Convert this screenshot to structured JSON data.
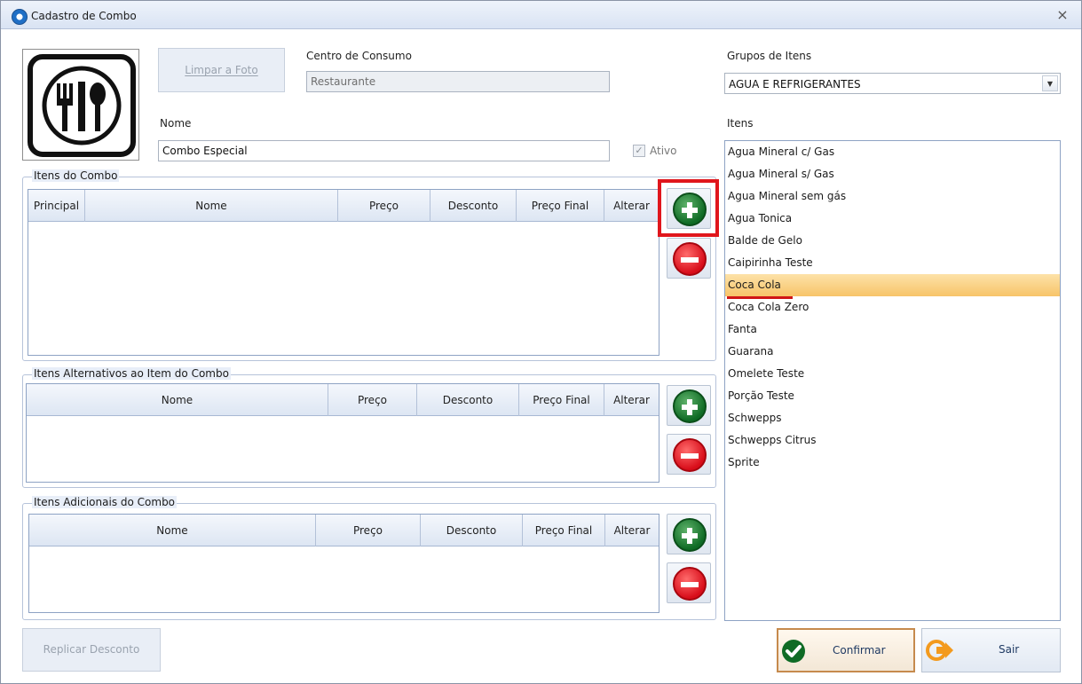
{
  "window": {
    "title": "Cadastro de Combo",
    "close": "×"
  },
  "photo": {
    "clear_button": "Limpar a Foto"
  },
  "centro": {
    "label": "Centro de Consumo",
    "value": "Restaurante"
  },
  "nome": {
    "label": "Nome",
    "value": "Combo Especial"
  },
  "ativo": {
    "label": "Ativo",
    "checked": true
  },
  "grupos": {
    "label": "Grupos de Itens",
    "value": "AGUA E REFRIGERANTES"
  },
  "itens": {
    "label": "Itens",
    "items": [
      "Agua Mineral c/ Gas",
      "Agua Mineral s/ Gas",
      "Agua Mineral sem gás",
      "Agua Tonica",
      "Balde de Gelo",
      "Caipirinha Teste",
      "Coca Cola",
      "Coca Cola Zero",
      "Fanta",
      "Guarana",
      "Omelete Teste",
      "Porção Teste",
      "Schwepps",
      "Schwepps Citrus",
      "Sprite"
    ],
    "selected_index": 6
  },
  "combo": {
    "title": "Itens do Combo",
    "columns": [
      "Principal",
      "Nome",
      "Preço",
      "Desconto",
      "Preço Final",
      "Alterar"
    ]
  },
  "alternativos": {
    "title": "Itens Alternativos ao Item do Combo",
    "columns": [
      "Nome",
      "Preço",
      "Desconto",
      "Preço Final",
      "Alterar"
    ]
  },
  "adicionais": {
    "title": "Itens Adicionais do Combo",
    "columns": [
      "Nome",
      "Preço",
      "Desconto",
      "Preço Final",
      "Alterar"
    ]
  },
  "footer": {
    "replicar": "Replicar Desconto",
    "confirmar": "Confirmar",
    "sair": "Sair"
  },
  "colors": {
    "accent": "#1f6fc6",
    "add": "#0f6b25",
    "remove": "#d80d1a",
    "highlight": "#e0161c",
    "selection": "#f7c469"
  }
}
